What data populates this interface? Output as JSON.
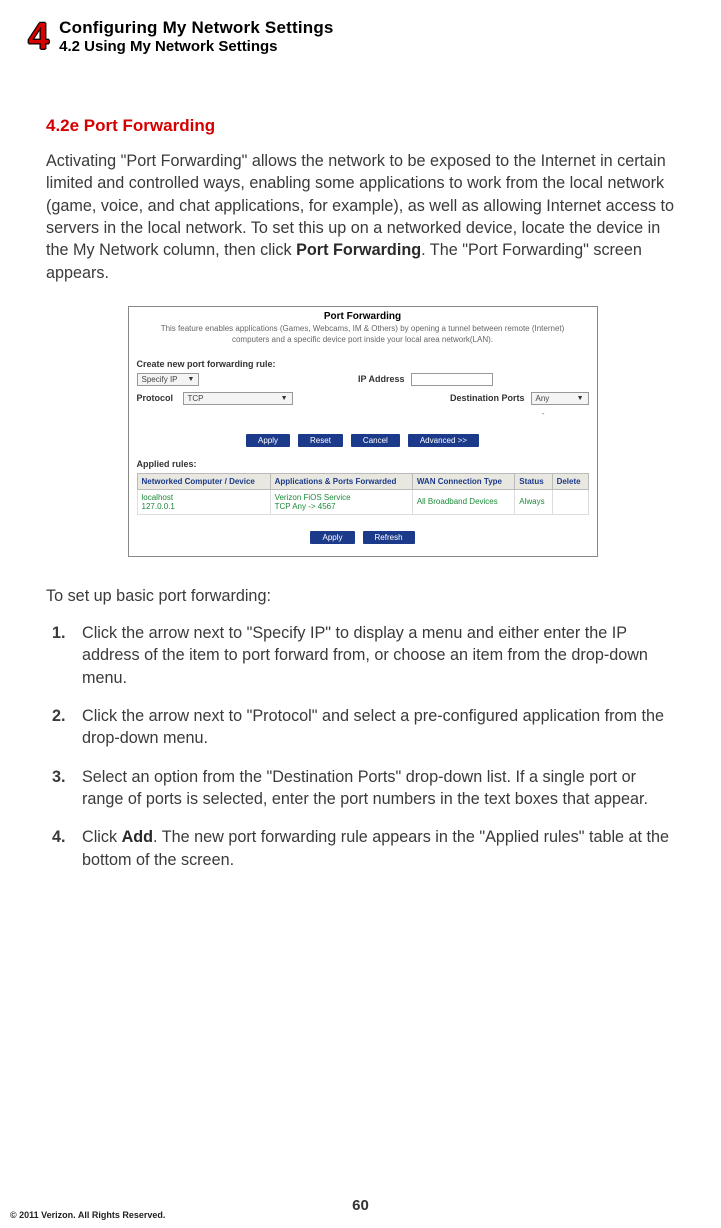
{
  "chapter_number": "4",
  "chapter_title": "Configuring My Network Settings",
  "section_number_title": "4.2  Using My Network Settings",
  "subsection_heading": "4.2e  Port Forwarding",
  "intro_paragraph_pre": "Activating \"Port Forwarding\" allows the network to be exposed to the Internet in certain limited and controlled ways, enabling some applications to work from the local network (game, voice, and chat applications, for example), as well as allowing Internet access to servers in the local network. To set this up on a networked device, locate the device in the My Network column, then click ",
  "intro_paragraph_bold": "Port Forwarding",
  "intro_paragraph_post": ". The \"Port Forwarding\" screen appears.",
  "screenshot": {
    "title": "Port Forwarding",
    "subtitle": "This feature enables applications (Games, Webcams, IM & Others) by opening a tunnel between remote (Internet) computers and a specific device port inside your local area network(LAN).",
    "create_label": "Create new port forwarding rule:",
    "specify_ip": "Specify IP",
    "ip_address_label": "IP Address",
    "protocol_label": "Protocol",
    "protocol_value": "TCP",
    "dest_ports_label": "Destination Ports",
    "dest_ports_value": "Any",
    "buttons1": [
      "Apply",
      "Reset",
      "Cancel",
      "Advanced >>"
    ],
    "applied_label": "Applied rules:",
    "table_headers": [
      "Networked Computer / Device",
      "Applications & Ports Forwarded",
      "WAN Connection Type",
      "Status",
      "Delete"
    ],
    "table_row": {
      "device_line1": "localhost",
      "device_line2": "127.0.0.1",
      "apps_line1": "Verizon FiOS Service",
      "apps_line2": "TCP Any -> 4567",
      "wan": "All Broadband Devices",
      "status": "Always",
      "delete": ""
    },
    "buttons2": [
      "Apply",
      "Refresh"
    ]
  },
  "instructions_lead": "To set up basic port forwarding:",
  "steps": [
    {
      "n": "1.",
      "pre": "Click the arrow next to \"Specify IP\" to display  a menu and either enter the IP address of the item to port forward from, or choose an item from the drop-down menu.",
      "bold": "",
      "post": ""
    },
    {
      "n": "2.",
      "pre": "Click the arrow next to \"Protocol\" and select a pre-configured application from the drop-down menu.",
      "bold": "",
      "post": ""
    },
    {
      "n": "3.",
      "pre": "Select an option from the \"Destination Ports\" drop-down list. If a single port or range of ports is selected, enter the port numbers in the text boxes that appear.",
      "bold": "",
      "post": ""
    },
    {
      "n": "4.",
      "pre": "Click ",
      "bold": "Add",
      "post": ". The new port forwarding rule appears in the \"Applied rules\" table at the bottom of the screen."
    }
  ],
  "page_number": "60",
  "copyright": "© 2011 Verizon. All Rights Reserved."
}
